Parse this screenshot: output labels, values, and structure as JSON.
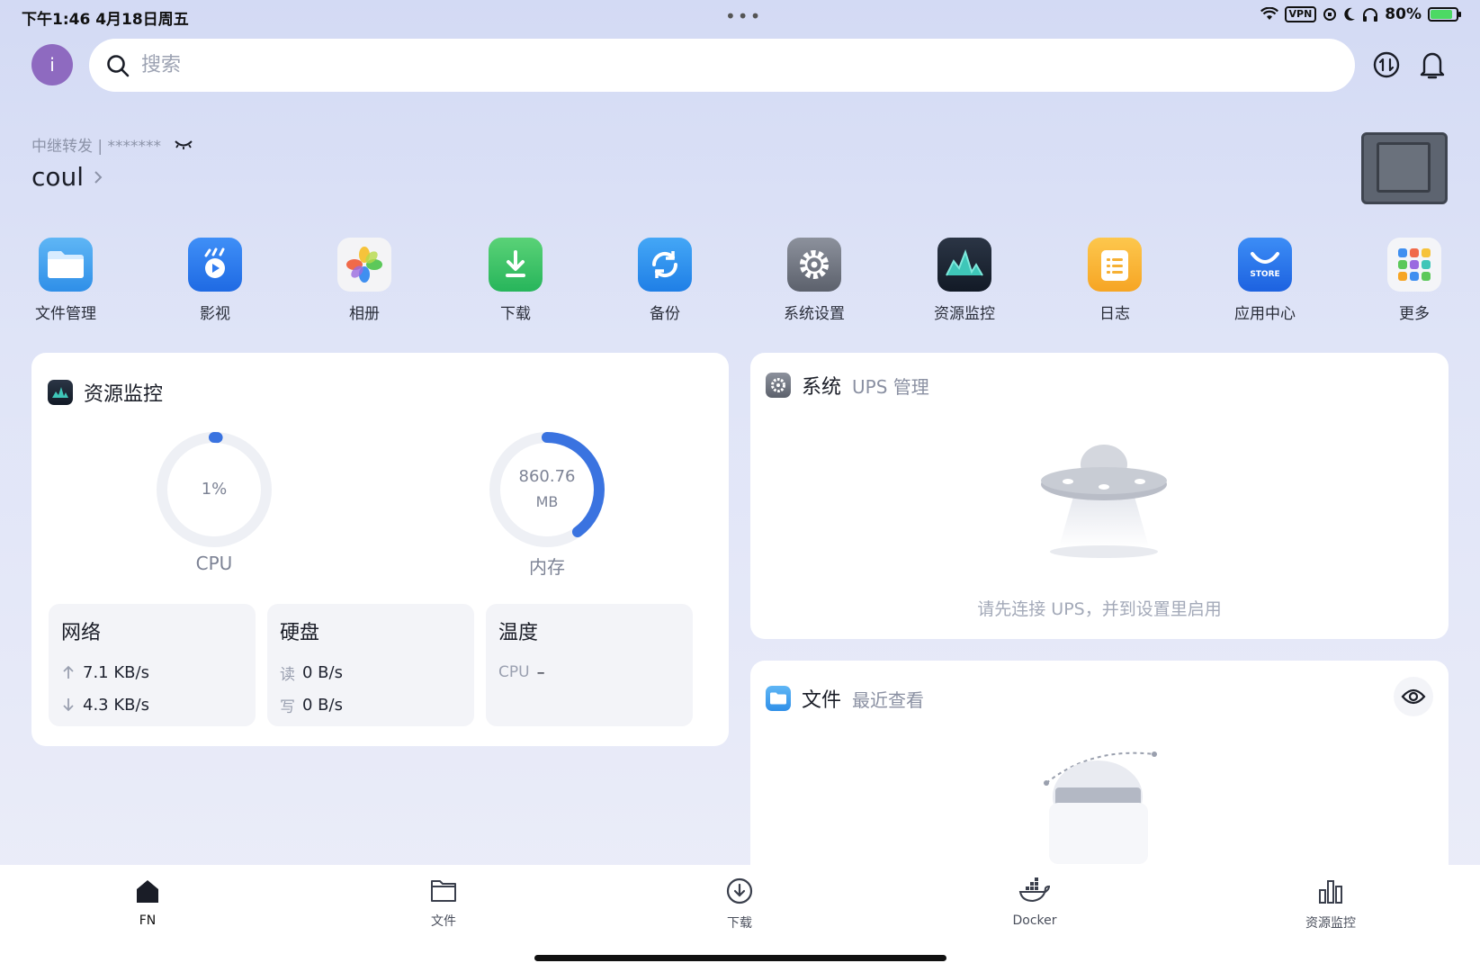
{
  "status_bar": {
    "time": "下午1:46  4月18日周五",
    "dots": "•••",
    "vpn": "VPN",
    "battery": "80%"
  },
  "header": {
    "avatar_letter": "i",
    "search_placeholder": "搜索"
  },
  "device": {
    "subtitle": "中继转发 | *******",
    "name": "coul"
  },
  "apps": [
    {
      "label": "文件管理",
      "icon": "folder-icon"
    },
    {
      "label": "影视",
      "icon": "video-icon"
    },
    {
      "label": "相册",
      "icon": "photos-icon"
    },
    {
      "label": "下载",
      "icon": "download-icon"
    },
    {
      "label": "备份",
      "icon": "backup-icon"
    },
    {
      "label": "系统设置",
      "icon": "gear-icon"
    },
    {
      "label": "资源监控",
      "icon": "monitor-icon"
    },
    {
      "label": "日志",
      "icon": "log-icon"
    },
    {
      "label": "应用中心",
      "icon": "store-icon"
    },
    {
      "label": "更多",
      "icon": "more-apps-icon"
    }
  ],
  "store_badge": "STORE",
  "resource_card": {
    "title": "资源监控",
    "cpu": {
      "value": "1%",
      "label": "CPU",
      "fraction": 0.01
    },
    "memory": {
      "value_line1": "860.76",
      "value_line2": "MB",
      "label": "内存",
      "fraction": 0.4
    },
    "network": {
      "title": "网络",
      "up": "7.1 KB/s",
      "down": "4.3 KB/s"
    },
    "disk": {
      "title": "硬盘",
      "read_key": "读",
      "read": "0 B/s",
      "write_key": "写",
      "write": "0 B/s"
    },
    "temperature": {
      "title": "温度",
      "cpu_key": "CPU",
      "cpu": "–"
    }
  },
  "system_card": {
    "title": "系统",
    "subtitle": "UPS 管理",
    "empty_text": "请先连接 UPS，并到设置里启用"
  },
  "files_card": {
    "title": "文件",
    "subtitle": "最近查看"
  },
  "bottom_nav": [
    {
      "label": "FN",
      "icon": "home-icon"
    },
    {
      "label": "文件",
      "icon": "folder-outline-icon"
    },
    {
      "label": "下载",
      "icon": "download-cloud-icon"
    },
    {
      "label": "Docker",
      "icon": "docker-icon"
    },
    {
      "label": "资源监控",
      "icon": "bar-chart-icon"
    }
  ],
  "colors": {
    "accent": "#3a73e0",
    "ring_track": "#eef0f5"
  }
}
